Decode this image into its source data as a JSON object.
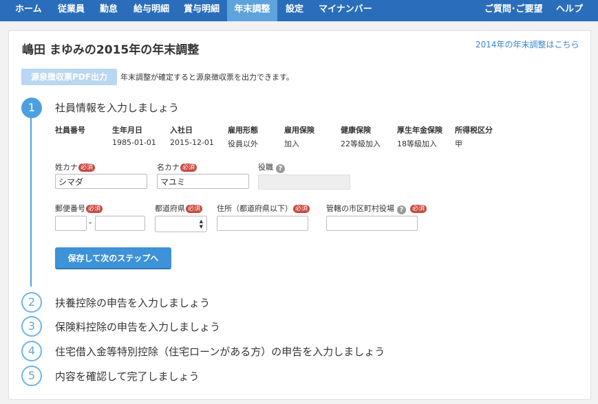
{
  "nav": {
    "items": [
      "ホーム",
      "従業員",
      "勤怠",
      "給与明細",
      "賞与明細",
      "年末調整",
      "設定",
      "マイナンバー"
    ],
    "active": "年末調整",
    "right": [
      "ご質問･ご要望",
      "ヘルプ"
    ]
  },
  "header": {
    "title": "嶋田 まゆみの2015年の年末調整",
    "prev_year_link": "2014年の年末調整はこちら"
  },
  "pdf": {
    "button_label": "源泉徴収票PDF出力",
    "note": "年末調整が確定すると源泉徴収票を出力できます。"
  },
  "steps": [
    {
      "number": "1",
      "title": "社員情報を入力しましょう"
    },
    {
      "number": "2",
      "title": "扶養控除の申告を入力しましょう"
    },
    {
      "number": "3",
      "title": "保険料控除の申告を入力しましょう"
    },
    {
      "number": "4",
      "title": "住宅借入金等特別控除（住宅ローンがある方）の申告を入力しましょう"
    },
    {
      "number": "5",
      "title": "内容を確認して完了しましょう"
    }
  ],
  "employee_table": {
    "headers": [
      "社員番号",
      "生年月日",
      "入社日",
      "雇用形態",
      "雇用保険",
      "健康保険",
      "厚生年金保険",
      "所得税区分"
    ],
    "values": [
      "",
      "1985-01-01",
      "2015-12-01",
      "役員以外",
      "加入",
      "22等級加入",
      "18等級加入",
      "甲"
    ]
  },
  "form": {
    "required_badge": "必須",
    "help_glyph": "?",
    "last_kana_label": "姓カナ",
    "last_kana_value": "シマダ",
    "first_kana_label": "名カナ",
    "first_kana_value": "マユミ",
    "position_label": "役職",
    "position_value": "",
    "postal_label": "郵便番号",
    "postal_1": "",
    "postal_2": "",
    "postal_sep": "-",
    "prefecture_label": "都道府県",
    "prefecture_value": "",
    "address_label": "住所（都道府県以下）",
    "address_value": "",
    "municipality_label": "管轄の市区町村役場",
    "municipality_value": "",
    "save_button": "保存して次のステップへ"
  },
  "colors": {
    "nav_bg": "#2a6ebb",
    "nav_active": "#5fa3dc",
    "accent": "#4da0e0",
    "required": "#c9483e",
    "pdf_disabled": "#b9d6f2"
  },
  "icons": {
    "help": "question-circle-icon",
    "select_arrow": "updown-chevron-icon"
  }
}
